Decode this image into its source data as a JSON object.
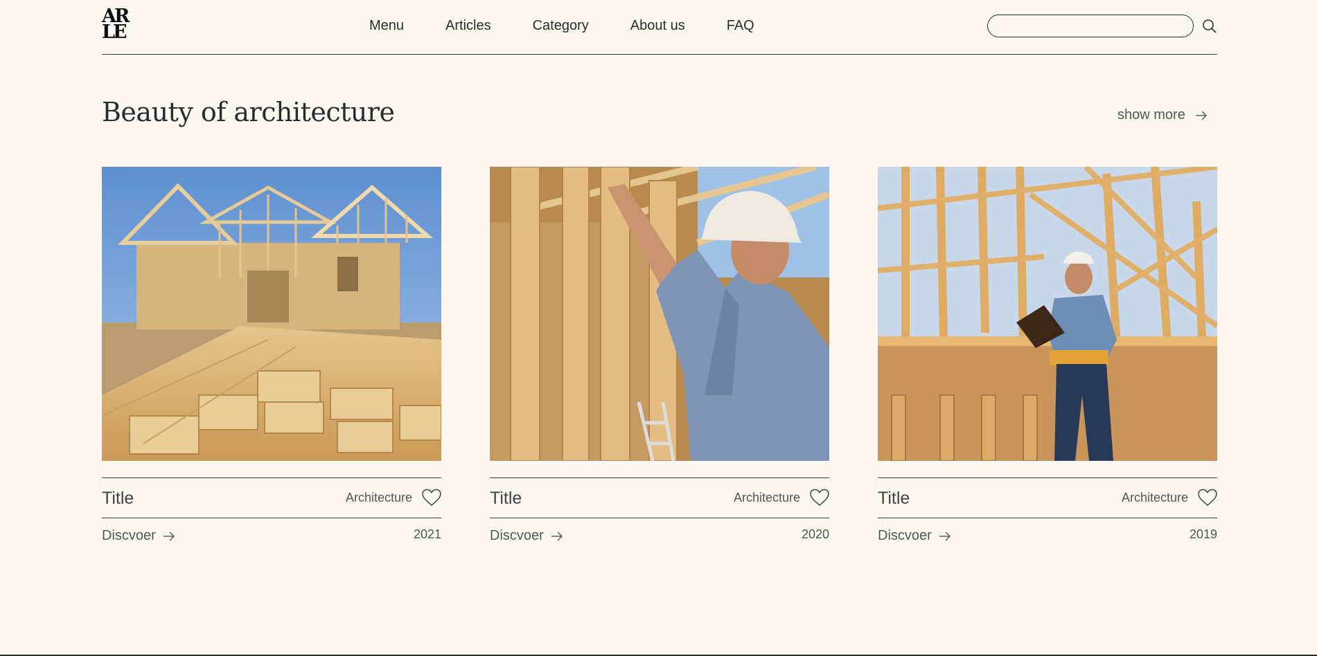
{
  "header": {
    "logo_top": "AR",
    "logo_bottom": "LE",
    "nav": [
      "Menu",
      "Articles",
      "Category",
      "About us",
      "FAQ"
    ],
    "search_value": "",
    "search_icon": "search-icon"
  },
  "section": {
    "title": "Beauty of architecture",
    "show_more_label": "show more"
  },
  "cards": [
    {
      "title": "Title",
      "category": "Architecture",
      "discover": "Discvoer",
      "year": "2021",
      "image": "lumber-stack-house-frame"
    },
    {
      "title": "Title",
      "category": "Architecture",
      "discover": "Discvoer",
      "year": "2020",
      "image": "worker-hard-hat-framing"
    },
    {
      "title": "Title",
      "category": "Architecture",
      "discover": "Discvoer",
      "year": "2019",
      "image": "inspector-clipboard-framing"
    }
  ],
  "colors": {
    "background": "#fdf7f2",
    "text": "#2b2b2b",
    "wood": "#d8ad6a",
    "sky": "#6f9ed8"
  }
}
